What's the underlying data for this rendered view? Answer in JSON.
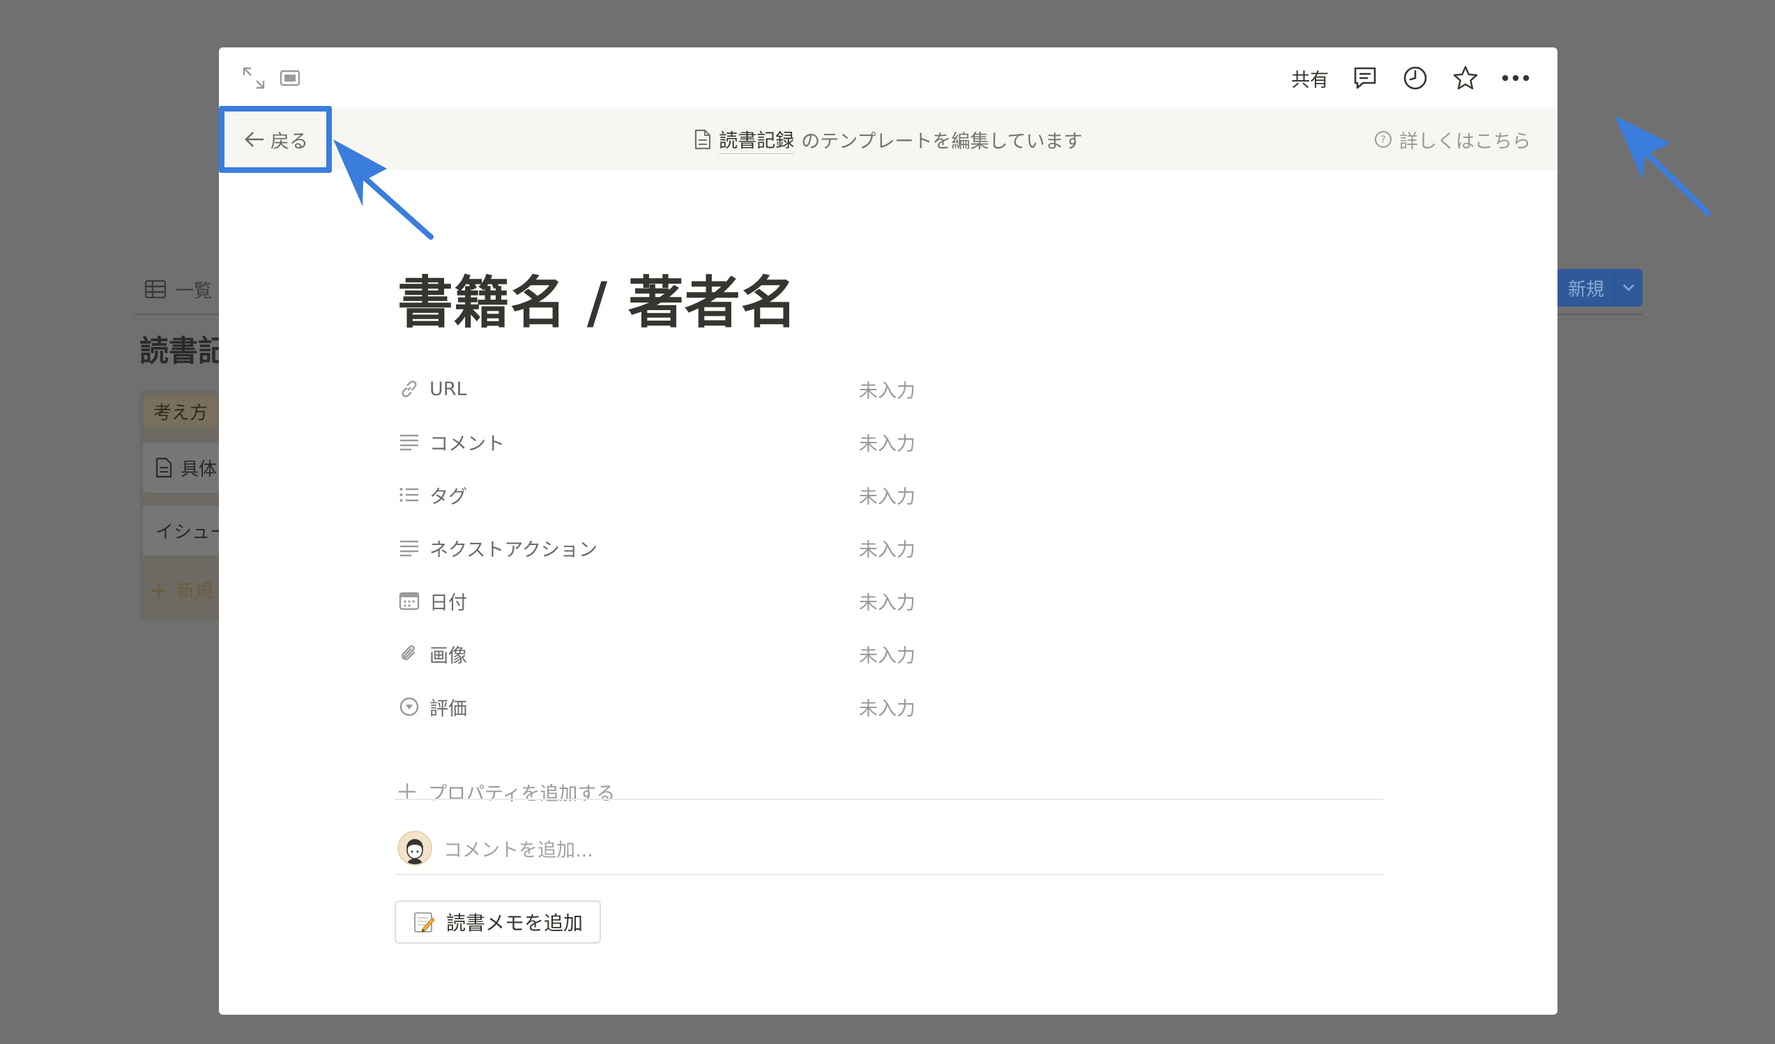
{
  "background": {
    "tab_label": "一覧",
    "title": "読書記",
    "group_tag": "考え方",
    "cards": [
      "具体",
      "イシュー"
    ],
    "new_row_label": "新規",
    "new_button_label": "新規"
  },
  "topbar": {
    "share_label": "共有",
    "icons": [
      "expand-icon",
      "peek-mode-icon",
      "comment-icon",
      "history-icon",
      "favorite-star-icon",
      "more-icon"
    ]
  },
  "template_bar": {
    "back_label": "戻る",
    "database_name": "読書記録",
    "editing_text": "のテンプレートを編集しています",
    "learn_more_label": "詳しくはこちら"
  },
  "page": {
    "title": "書籍名 / 著者名",
    "properties": [
      {
        "name": "URL",
        "icon": "link-icon",
        "value": "未入力"
      },
      {
        "name": "コメント",
        "icon": "text-icon",
        "value": "未入力"
      },
      {
        "name": "タグ",
        "icon": "multi-select-icon",
        "value": "未入力"
      },
      {
        "name": "ネクストアクション",
        "icon": "text-icon",
        "value": "未入力"
      },
      {
        "name": "日付",
        "icon": "calendar-icon",
        "value": "未入力"
      },
      {
        "name": "画像",
        "icon": "attachment-icon",
        "value": "未入力"
      },
      {
        "name": "評価",
        "icon": "select-icon",
        "value": "未入力"
      }
    ],
    "add_property_label": "プロパティを追加する",
    "comment_placeholder": "コメントを追加...",
    "template_button_label": "読書メモを追加"
  },
  "colors": {
    "annotation_blue": "#3b7ddd",
    "overlay": "#707070",
    "template_bar_bg": "#f7f6f3"
  }
}
